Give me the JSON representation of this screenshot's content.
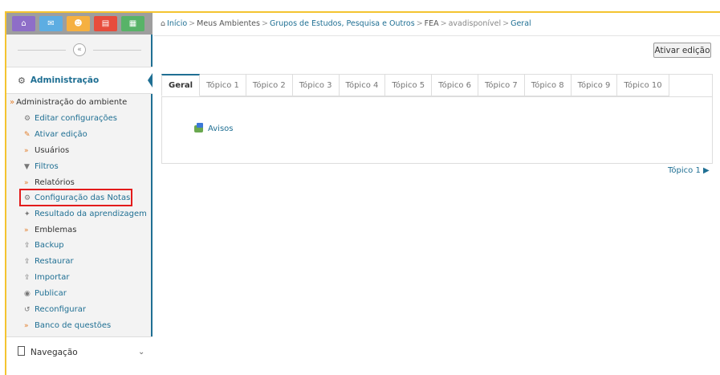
{
  "quick_bar": {
    "buttons": [
      {
        "name": "home-icon",
        "glyph": "⌂",
        "color": "#8e6ec8"
      },
      {
        "name": "mail-icon",
        "glyph": "✉",
        "color": "#5dade2"
      },
      {
        "name": "users-icon",
        "glyph": "☻",
        "color": "#f5b041"
      },
      {
        "name": "document-icon",
        "glyph": "▤",
        "color": "#e74c3c"
      },
      {
        "name": "grid-icon",
        "glyph": "▦",
        "color": "#58b368"
      }
    ]
  },
  "sidebar": {
    "collapse_glyph": "«",
    "admin_title": "Administração",
    "root_item": "Administração do ambiente",
    "items": [
      {
        "label": "Editar configurações",
        "icon": "gear-icon",
        "glyph": "⚙"
      },
      {
        "label": "Ativar edição",
        "icon": "pencil-icon",
        "glyph": "✎"
      },
      {
        "label": "Usuários",
        "icon": "expand-arrow-icon",
        "glyph": "»"
      },
      {
        "label": "Filtros",
        "icon": "filter-icon",
        "glyph": "▼"
      },
      {
        "label": "Relatórios",
        "icon": "expand-arrow-icon",
        "glyph": "»"
      },
      {
        "label": "Configuração das Notas",
        "icon": "gear-icon",
        "glyph": "⚙"
      },
      {
        "label": "Resultado da aprendizagem",
        "icon": "outcome-icon",
        "glyph": "✦"
      },
      {
        "label": "Emblemas",
        "icon": "expand-arrow-icon",
        "glyph": "»"
      },
      {
        "label": "Backup",
        "icon": "upload-icon",
        "glyph": "⇪"
      },
      {
        "label": "Restaurar",
        "icon": "upload-icon",
        "glyph": "⇪"
      },
      {
        "label": "Importar",
        "icon": "upload-icon",
        "glyph": "⇪"
      },
      {
        "label": "Publicar",
        "icon": "publish-icon",
        "glyph": "◉"
      },
      {
        "label": "Reconfigurar",
        "icon": "reset-icon",
        "glyph": "↺"
      },
      {
        "label": "Banco de questões",
        "icon": "expand-arrow-icon",
        "glyph": "»"
      }
    ],
    "navigation_title": "Navegação",
    "navigation_chevron": "⌄"
  },
  "breadcrumb": {
    "items": [
      "Início",
      "Meus Ambientes",
      "Grupos de Estudos, Pesquisa e Outros",
      "FEA",
      "avadisponível",
      "Geral"
    ],
    "separator": ">"
  },
  "toolbar": {
    "edit_label": "Ativar edição"
  },
  "tabs": [
    "Geral",
    "Tópico 1",
    "Tópico 2",
    "Tópico 3",
    "Tópico 4",
    "Tópico 5",
    "Tópico 6",
    "Tópico 7",
    "Tópico 8",
    "Tópico 9",
    "Tópico 10"
  ],
  "content": {
    "forum_label": "Avisos",
    "next_topic": "Tópico 1 ▶"
  },
  "colors": {
    "accent": "#1f6f93",
    "frame": "#f4c430",
    "highlight": "#e31b1b"
  }
}
